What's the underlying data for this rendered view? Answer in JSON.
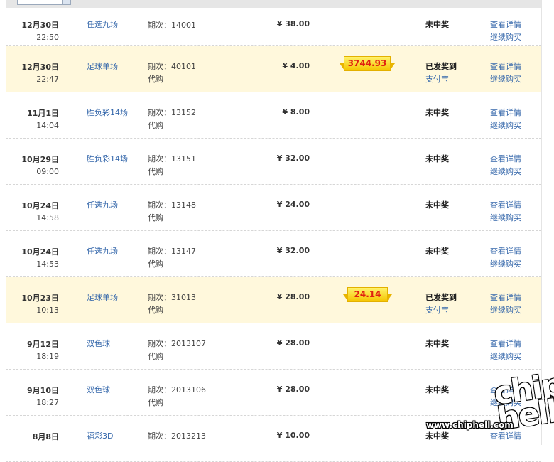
{
  "colors": {
    "link": "#3366aa",
    "won_row_bg": "#fff8dc",
    "prize_text": "#e02010",
    "prize_bg": "#f5c400"
  },
  "rows": [
    {
      "date": "12月30日",
      "time": "22:50",
      "game": "任选九场",
      "issue": "期次：14001",
      "buy": "",
      "amount": "¥ 38.00",
      "prize": "",
      "status": "未中奖",
      "alipay": "",
      "link1": "查看详情",
      "link2": "继续购买"
    },
    {
      "date": "12月30日",
      "time": "22:47",
      "game": "足球单场",
      "issue": "期次：40101",
      "buy": "代购",
      "amount": "¥ 4.00",
      "prize": "3744.93",
      "status": "已发奖到",
      "alipay": "支付宝",
      "link1": "查看详情",
      "link2": "继续购买"
    },
    {
      "date": "11月1日",
      "time": "14:04",
      "game": "胜负彩14场",
      "issue": "期次：13152",
      "buy": "代购",
      "amount": "¥ 8.00",
      "prize": "",
      "status": "未中奖",
      "alipay": "",
      "link1": "查看详情",
      "link2": "继续购买"
    },
    {
      "date": "10月29日",
      "time": "09:00",
      "game": "胜负彩14场",
      "issue": "期次：13151",
      "buy": "代购",
      "amount": "¥ 32.00",
      "prize": "",
      "status": "未中奖",
      "alipay": "",
      "link1": "查看详情",
      "link2": "继续购买"
    },
    {
      "date": "10月24日",
      "time": "14:58",
      "game": "任选九场",
      "issue": "期次：13148",
      "buy": "代购",
      "amount": "¥ 24.00",
      "prize": "",
      "status": "未中奖",
      "alipay": "",
      "link1": "查看详情",
      "link2": "继续购买"
    },
    {
      "date": "10月24日",
      "time": "14:53",
      "game": "任选九场",
      "issue": "期次：13147",
      "buy": "代购",
      "amount": "¥ 32.00",
      "prize": "",
      "status": "未中奖",
      "alipay": "",
      "link1": "查看详情",
      "link2": "继续购买"
    },
    {
      "date": "10月23日",
      "time": "10:13",
      "game": "足球单场",
      "issue": "期次：31013",
      "buy": "代购",
      "amount": "¥ 28.00",
      "prize": "24.14",
      "status": "已发奖到",
      "alipay": "支付宝",
      "link1": "查看详情",
      "link2": "继续购买"
    },
    {
      "date": "9月12日",
      "time": "18:19",
      "game": "双色球",
      "issue": "期次：2013107",
      "buy": "代购",
      "amount": "¥ 28.00",
      "prize": "",
      "status": "未中奖",
      "alipay": "",
      "link1": "查看详情",
      "link2": "继续购买"
    },
    {
      "date": "9月10日",
      "time": "18:27",
      "game": "双色球",
      "issue": "期次：2013106",
      "buy": "代购",
      "amount": "¥ 28.00",
      "prize": "",
      "status": "未中奖",
      "alipay": "",
      "link1": "查看详情",
      "link2": "继续购买"
    },
    {
      "date": "8月8日",
      "time": "",
      "game": "福彩3D",
      "issue": "期次：2013213",
      "buy": "",
      "amount": "¥ 10.00",
      "prize": "",
      "status": "未中奖",
      "alipay": "",
      "link1": "查看详情",
      "link2": ""
    }
  ],
  "watermark": {
    "logo": "chip hell",
    "url": "www.chiphell.com"
  }
}
